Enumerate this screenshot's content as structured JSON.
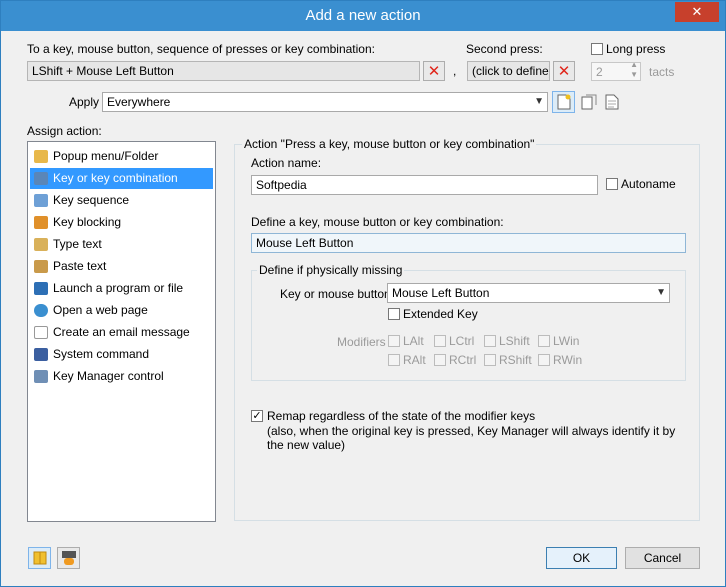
{
  "window": {
    "title": "Add a new action",
    "close_glyph": "✕",
    "accent": "#3a8fd0"
  },
  "key_section": {
    "label": "To a key, mouse button, sequence of presses or key combination:",
    "value": "LShift + Mouse Left Button",
    "comma": ",",
    "second_press_label": "Second press:",
    "second_press_value": "(click to define)",
    "long_press_label": "Long press",
    "tacts_value": "2",
    "tacts_label": "tacts"
  },
  "apply": {
    "label": "Apply",
    "value": "Everywhere"
  },
  "assign": {
    "label": "Assign action:",
    "items": [
      {
        "label": "Popup menu/Folder",
        "icon": "folder-icon",
        "color": "#e8b84a"
      },
      {
        "label": "Key or key combination",
        "icon": "keyboard-icon",
        "color": "#5a86b8"
      },
      {
        "label": "Key sequence",
        "icon": "keys-icon",
        "color": "#6ea0d6"
      },
      {
        "label": "Key blocking",
        "icon": "lock-icon",
        "color": "#e0902a"
      },
      {
        "label": "Type text",
        "icon": "clipboard-icon",
        "color": "#d9b15a"
      },
      {
        "label": "Paste text",
        "icon": "paste-icon",
        "color": "#c99a4a"
      },
      {
        "label": "Launch a program or file",
        "icon": "program-icon",
        "color": "#2d6fb5"
      },
      {
        "label": "Open a web page",
        "icon": "globe-icon",
        "color": "#3a8fd0"
      },
      {
        "label": "Create an email message",
        "icon": "envelope-icon",
        "color": "#d04a3a"
      },
      {
        "label": "System command",
        "icon": "monitor-icon",
        "color": "#3b5fa0"
      },
      {
        "label": "Key Manager control",
        "icon": "app-icon",
        "color": "#6f8fb5"
      }
    ],
    "selected_index": 1
  },
  "action_panel": {
    "title": "Action \"Press a key, mouse button or key combination\"",
    "name_label": "Action name:",
    "name_value": "Softpedia",
    "autoname_label": "Autoname",
    "define_label": "Define a key, mouse button or key combination:",
    "define_value": "Mouse Left Button",
    "missing_group": {
      "title": "Define if physically missing",
      "key_label": "Key or mouse button",
      "key_value": "Mouse Left Button",
      "extended_label": "Extended Key",
      "modifiers_label": "Modifiers",
      "modifiers_row1": [
        "LAlt",
        "LCtrl",
        "LShift",
        "LWin"
      ],
      "modifiers_row2": [
        "RAlt",
        "RCtrl",
        "RShift",
        "RWin"
      ]
    },
    "remap_line1": "Remap regardless of the state of the modifier keys",
    "remap_line2": "(also, when the original key is pressed, Key Manager will always identify it by",
    "remap_line3": "the new value)",
    "check_glyph": "✓"
  },
  "footer": {
    "ok_label": "OK",
    "cancel_label": "Cancel"
  }
}
